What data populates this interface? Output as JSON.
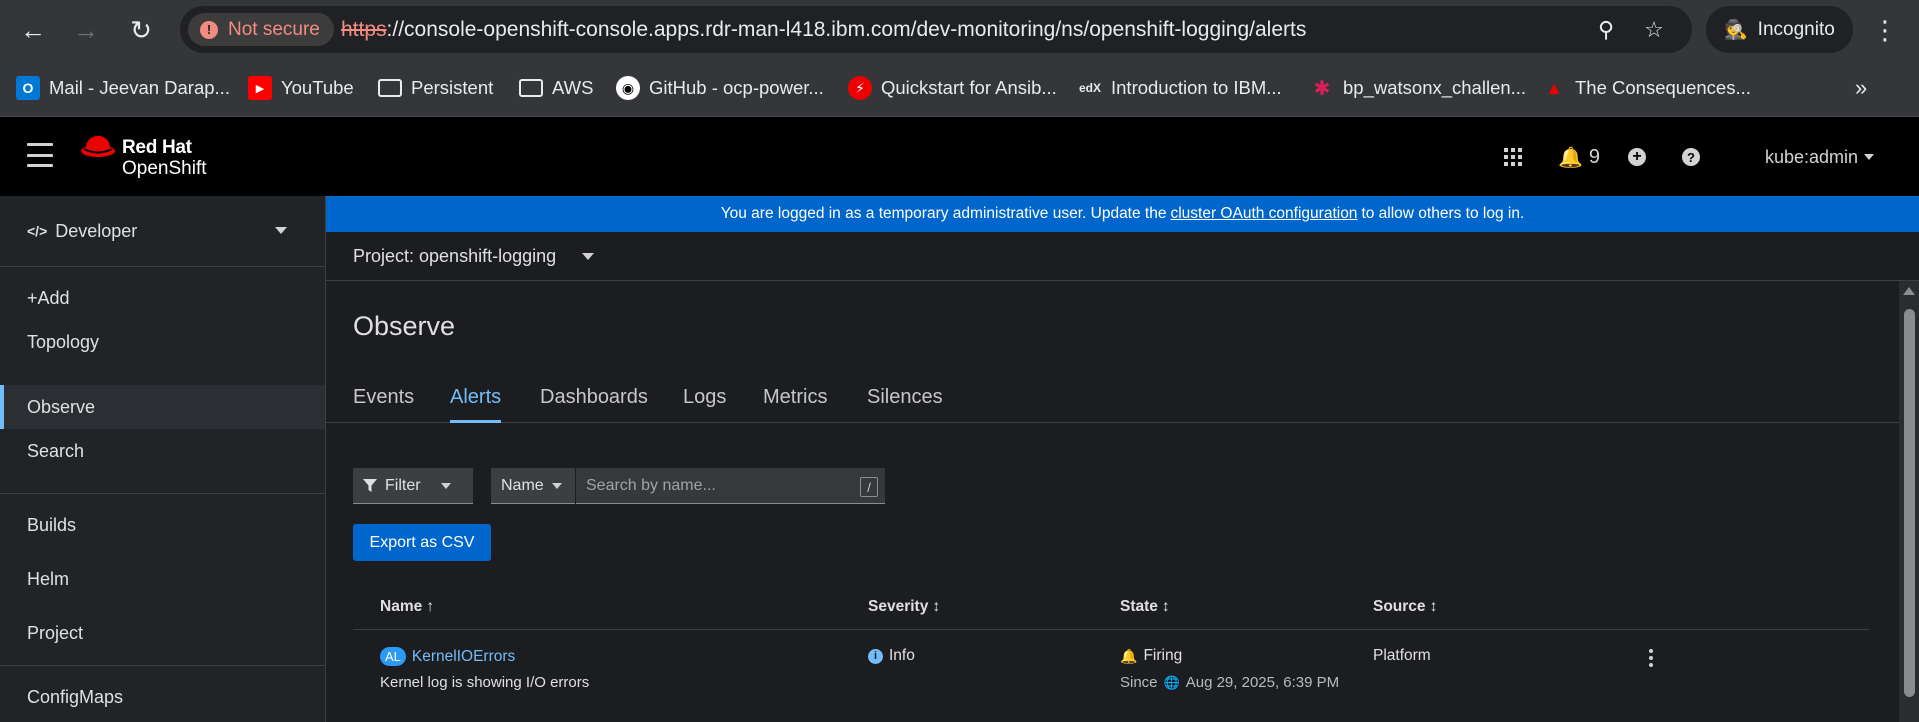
{
  "browser": {
    "security_label": "Not secure",
    "url_scheme": "https",
    "url_rest": "://console-openshift-console.apps.rdr-man-l418.ibm.com/dev-monitoring/ns/openshift-logging/alerts",
    "incognito_label": "Incognito",
    "bookmarks": [
      {
        "label": "Mail - Jeevan Darap...",
        "icon": "outlook-icon",
        "color": "#0078d4"
      },
      {
        "label": "YouTube",
        "icon": "youtube-icon",
        "color": "#ff0000"
      },
      {
        "label": "Persistent",
        "icon": "folder-icon",
        "color": ""
      },
      {
        "label": "AWS",
        "icon": "folder-icon",
        "color": ""
      },
      {
        "label": "GitHub - ocp-power...",
        "icon": "github-icon",
        "color": "#ffffff"
      },
      {
        "label": "Quickstart for Ansib...",
        "icon": "lightning-icon",
        "color": "#e00"
      },
      {
        "label": "Introduction to IBM...",
        "icon": "edx-icon",
        "color": ""
      },
      {
        "label": "bp_watsonx_challen...",
        "icon": "slack-icon",
        "color": ""
      },
      {
        "label": "The Consequences...",
        "icon": "redhat-icon",
        "color": "#e00"
      }
    ]
  },
  "masthead": {
    "brand_line1": "Red Hat",
    "brand_line2": "OpenShift",
    "notifications_count": "9",
    "user": "kube:admin"
  },
  "sidebar": {
    "perspective": "Developer",
    "items": [
      {
        "label": "+Add"
      },
      {
        "label": "Topology"
      },
      {
        "label": "Observe"
      },
      {
        "label": "Search"
      },
      {
        "label": "Builds"
      },
      {
        "label": "Helm"
      },
      {
        "label": "Project"
      },
      {
        "label": "ConfigMaps"
      }
    ]
  },
  "banner": {
    "text_before": "You are logged in as a temporary administrative user. Update the",
    "link": "cluster OAuth configuration",
    "text_after": "to allow others to log in."
  },
  "project": {
    "label": "Project: openshift-logging"
  },
  "page": {
    "title": "Observe",
    "tabs": [
      "Events",
      "Alerts",
      "Dashboards",
      "Logs",
      "Metrics",
      "Silences"
    ],
    "active_tab": "Alerts"
  },
  "toolbar": {
    "filter_label": "Filter",
    "name_select": "Name",
    "search_placeholder": "Search by name...",
    "search_hint": "/",
    "export_label": "Export as CSV"
  },
  "table": {
    "headers": {
      "name": "Name",
      "severity": "Severity",
      "state": "State",
      "source": "Source"
    },
    "rows": [
      {
        "badge": "AL",
        "name": "KernelIOErrors",
        "description": "Kernel log is showing I/O errors",
        "severity": "Info",
        "state": "Firing",
        "since_label": "Since",
        "since": "Aug 29, 2025, 6:39 PM",
        "source": "Platform"
      }
    ]
  }
}
